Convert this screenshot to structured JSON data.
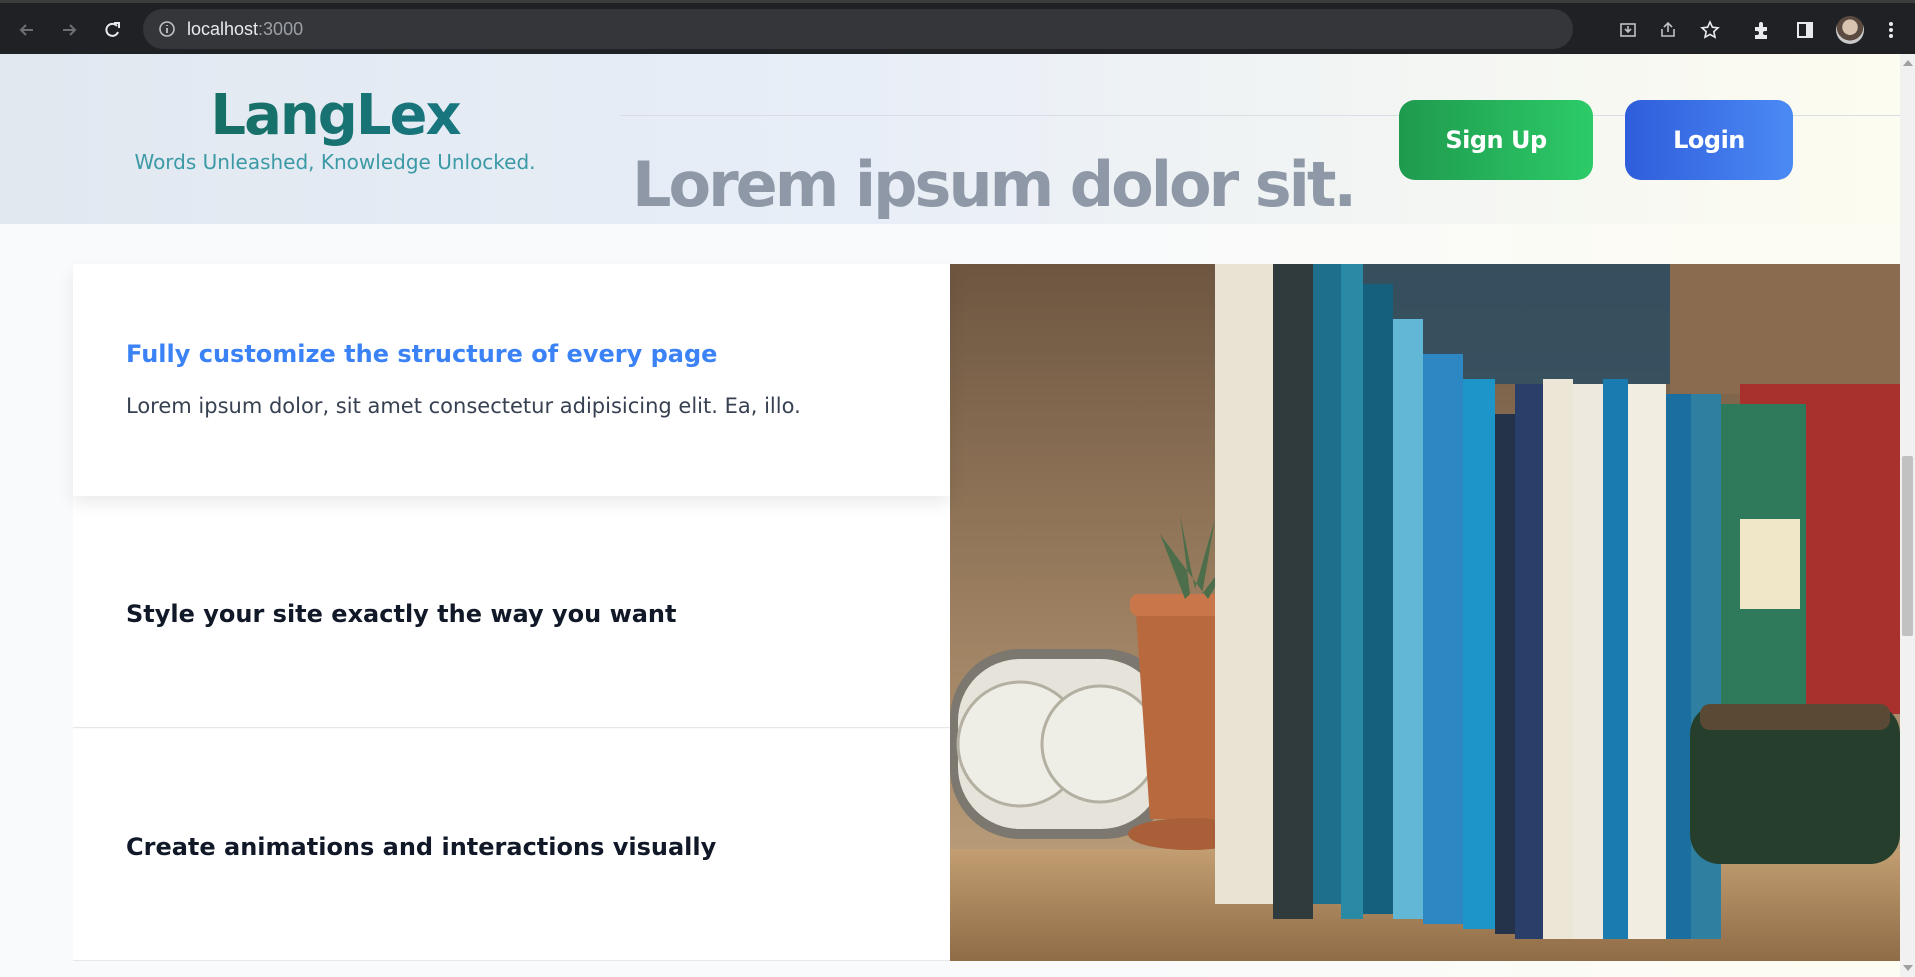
{
  "browser": {
    "url_host": "localhost",
    "url_port": ":3000",
    "icons": [
      "back-arrow-icon",
      "forward-arrow-icon",
      "reload-icon",
      "info-icon",
      "install-icon",
      "share-icon",
      "star-icon",
      "extensions-icon",
      "side-panel-icon",
      "menu-icon"
    ]
  },
  "header": {
    "brand_name": "LangLex",
    "tagline": "Words Unleashed, Knowledge Unlocked.",
    "hero_title": "Lorem ipsum dolor sit.",
    "signup_label": "Sign Up",
    "login_label": "Login"
  },
  "features": [
    {
      "title": "Fully customize the structure of every page",
      "description": "Lorem ipsum dolor, sit amet consectetur adipisicing elit. Ea, illo.",
      "active": true
    },
    {
      "title": "Style your site exactly the way you want",
      "active": false
    },
    {
      "title": "Create animations and interactions visually",
      "active": false
    }
  ],
  "colors": {
    "brand": "#166d5a",
    "accent_blue": "#3b82f6",
    "signup": "#22b35c",
    "login": "#3b73e8"
  }
}
